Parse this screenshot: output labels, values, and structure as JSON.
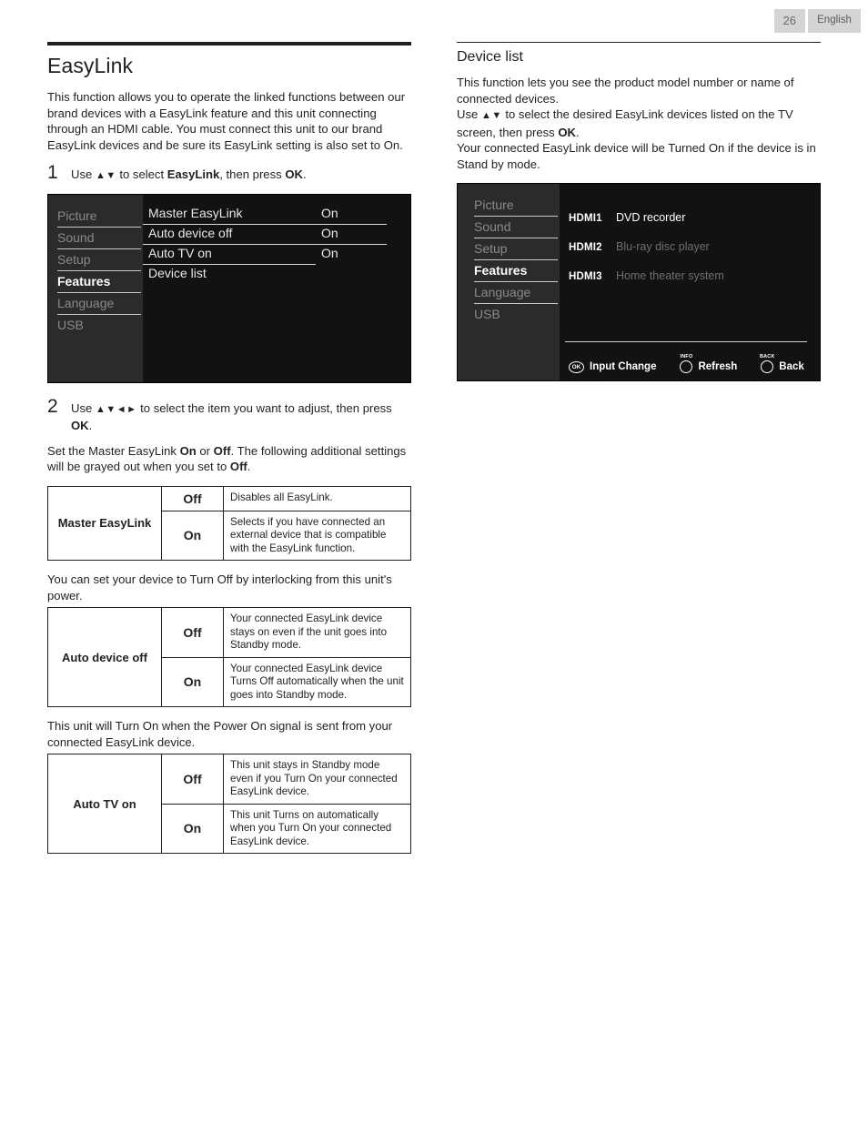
{
  "header": {
    "page_number": "26",
    "language": "English"
  },
  "left_column": {
    "heading": "EasyLink",
    "intro": "This function allows you to operate the linked functions between our brand devices with a EasyLink feature and this unit connecting through an HDMI cable. You must connect this unit to our brand EasyLink devices and be sure its EasyLink setting is also set to On.",
    "steps": [
      {
        "number": "1",
        "prefix": "Use",
        "arrows": "▲▼",
        "mid": "to select",
        "bold1": "EasyLink",
        "mid2": ", then press",
        "bold2": "OK",
        "suffix": "."
      },
      {
        "number": "2",
        "prefix": "Use",
        "arrows": "▲▼◄►",
        "mid": "to select the item you want to adjust, then press",
        "bold1": "OK",
        "suffix": "."
      }
    ],
    "osd": {
      "sidebar": [
        "Picture",
        "Sound",
        "Setup",
        "Features",
        "Language",
        "USB"
      ],
      "sidebar_selected": "Features",
      "rows": [
        {
          "label": "Master EasyLink",
          "value": "On"
        },
        {
          "label": "Auto device off",
          "value": "On"
        },
        {
          "label": "Auto TV on",
          "value": "On"
        },
        {
          "label": "Device list",
          "value": ""
        }
      ]
    },
    "para_master": {
      "a": "Set the Master EasyLink ",
      "b1": "On",
      "b": " or ",
      "b2": "Off",
      "c": ". The following additional settings will be grayed out when you set to ",
      "b3": "Off",
      "d": "."
    },
    "para_autodevice": "You can set your device to Turn Off by interlocking from this unit's power.",
    "para_autotv": "This unit will Turn On when the Power On signal is sent from your connected EasyLink device.",
    "tables": [
      {
        "name": "Master EasyLink",
        "rows": [
          {
            "value": "Off",
            "desc": "Disables all EasyLink."
          },
          {
            "value": "On",
            "desc": "Selects if you have connected an external device that is compatible with the EasyLink function."
          }
        ]
      },
      {
        "name": "Auto device off",
        "rows": [
          {
            "value": "Off",
            "desc": "Your connected EasyLink device stays on even if the unit goes into Standby mode."
          },
          {
            "value": "On",
            "desc": "Your connected EasyLink device Turns Off automatically when the unit goes into Standby mode."
          }
        ]
      },
      {
        "name": "Auto TV on",
        "rows": [
          {
            "value": "Off",
            "desc": "This unit stays in Standby mode even if you Turn On your connected EasyLink device."
          },
          {
            "value": "On",
            "desc": "This unit Turns on automatically when you Turn On your connected EasyLink device."
          }
        ]
      }
    ]
  },
  "right_column": {
    "heading": "Device list",
    "para1": "This function lets you see the product model number or name of connected devices.",
    "para2": {
      "a": "Use ",
      "arrows": "▲▼",
      "b": " to select the desired EasyLink devices listed on the TV screen, then press ",
      "bold": "OK",
      "c": "."
    },
    "para3": "Your connected EasyLink device will be Turned On if the device is in Stand by mode.",
    "osd": {
      "sidebar": [
        "Picture",
        "Sound",
        "Setup",
        "Features",
        "Language",
        "USB"
      ],
      "sidebar_selected": "Features",
      "devices": [
        {
          "port": "HDMI1",
          "name": "DVD recorder",
          "active": true
        },
        {
          "port": "HDMI2",
          "name": "Blu-ray disc player",
          "active": false
        },
        {
          "port": "HDMI3",
          "name": "Home theater system",
          "active": false
        }
      ],
      "footer": [
        {
          "key": "OK",
          "key_cap": "",
          "label": "Input Change",
          "icon": "ok-key-icon"
        },
        {
          "key": "",
          "key_cap": "INFO",
          "label": "Refresh",
          "icon": "info-key-icon"
        },
        {
          "key": "",
          "key_cap": "BACK",
          "label": "Back",
          "icon": "back-key-icon"
        }
      ]
    }
  }
}
